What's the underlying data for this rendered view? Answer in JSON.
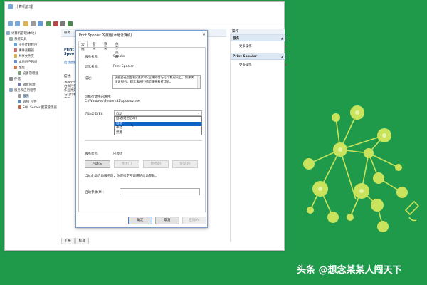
{
  "window": {
    "title": "计算机管理"
  },
  "tree": {
    "items": [
      {
        "label": "计算机管理(本地)"
      },
      {
        "label": "系统工具"
      },
      {
        "label": "任务计划程序"
      },
      {
        "label": "事件查看器"
      },
      {
        "label": "共享文件夹"
      },
      {
        "label": "本地用户和组"
      },
      {
        "label": "性能"
      },
      {
        "label": "设备管理器"
      },
      {
        "label": "存储"
      },
      {
        "label": "磁盘管理"
      },
      {
        "label": "服务和应用程序"
      },
      {
        "label": "服务"
      },
      {
        "label": "WMI 控件"
      },
      {
        "label": "SQL Server 配置管理器"
      }
    ]
  },
  "middle": {
    "header": "服务",
    "service_name": "Print Spoo",
    "link": "启动此服务",
    "desc_label": "描述:",
    "desc_text": "该服务在后台执行打印作业并处理与打印机的交互"
  },
  "actions": {
    "title": "操作",
    "section1": "服务",
    "item1": "更多操作",
    "section2": "Print Spooler",
    "item2": "更多操作"
  },
  "bottom_tabs": {
    "t1": "扩展",
    "t2": "标准"
  },
  "dialog": {
    "title": "Print Spooler 的属性(本地计算机)",
    "tabs": [
      "常规",
      "登录",
      "恢复",
      "依存关系"
    ],
    "service_name_label": "服务名称:",
    "service_name_value": "Spooler",
    "display_name_label": "显示名称:",
    "display_name_value": "Print Spooler",
    "desc_label": "描述:",
    "desc_value": "该服务在后台执行打印作业并处理与打印机的交互。如果关闭该服务，则无法进行打印或查看打印机。",
    "path_label": "可执行文件的路径:",
    "path_value": "C:\\Windows\\System32\\spoolsv.exe",
    "startup_type_label": "启动类型(E):",
    "startup_type_value": "自动",
    "startup_options": [
      "自动(延迟启动)",
      "自动",
      "手动",
      "禁用"
    ],
    "startup_highlighted": "自动",
    "status_label": "服务状态:",
    "status_value": "已停止",
    "buttons": {
      "start": "启动(S)",
      "stop": "停止(T)",
      "pause": "暂停(P)",
      "resume": "恢复(R)"
    },
    "hint": "当从此处启动服务时，你可指定所适用的启动参数。",
    "params_label": "启动参数(M):",
    "params_value": "",
    "ok": "确定",
    "cancel": "取消",
    "apply": "应用(A)"
  },
  "watermark": "头条 @想念某某人闯天下",
  "colors": {
    "background": "#1f9a4b",
    "graphic": "#c9e35c",
    "highlight": "#0a64c8"
  }
}
